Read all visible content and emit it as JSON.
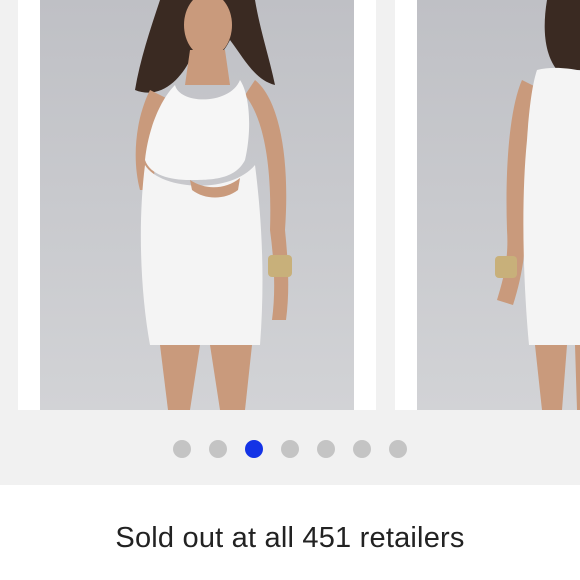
{
  "gallery": {
    "images": [
      {
        "icon": "product-photo-front",
        "alt": ""
      },
      {
        "icon": "product-photo-back",
        "alt": ""
      }
    ],
    "dots_count": 7,
    "active_index": 2,
    "colors": {
      "dot": "#c4c4c4",
      "dot_active": "#1433e6",
      "background": "#f1f1f1"
    }
  },
  "status": {
    "sold_out_text": "Sold out at all 451 retailers"
  }
}
